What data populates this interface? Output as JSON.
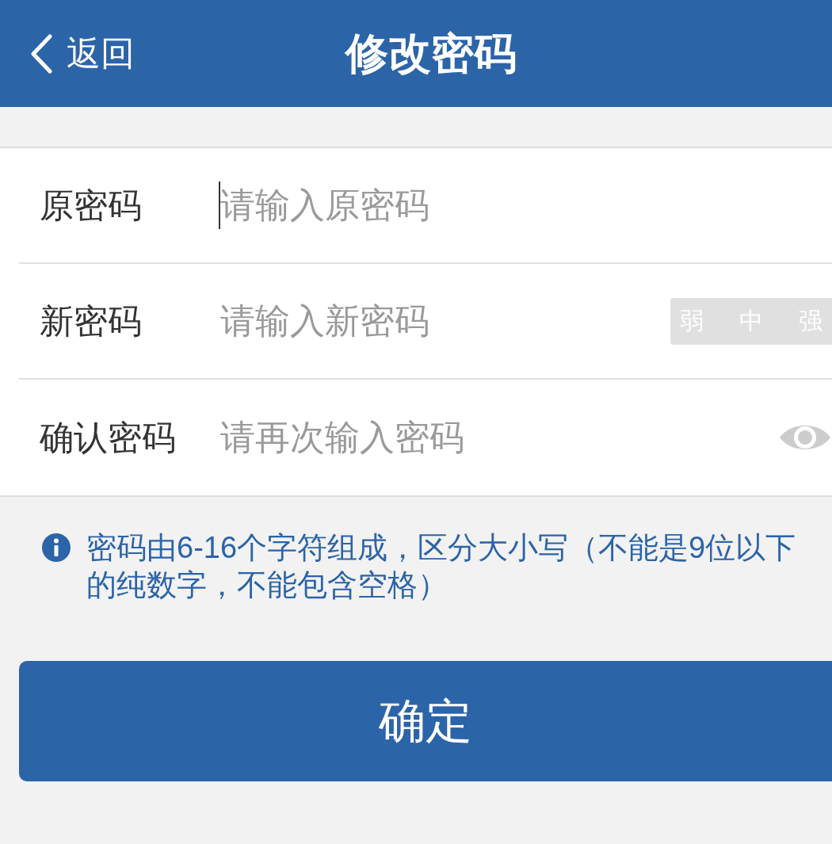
{
  "header": {
    "back_label": "返回",
    "title": "修改密码"
  },
  "fields": [
    {
      "kind": "plain",
      "label": "原密码",
      "placeholder": "请输入原密码",
      "focused": true
    },
    {
      "kind": "strength",
      "label": "新密码",
      "placeholder": "请输入新密码",
      "focused": false,
      "strength": [
        {
          "label": "弱",
          "active": false
        },
        {
          "label": "中",
          "active": false
        },
        {
          "label": "强",
          "active": false
        }
      ]
    },
    {
      "kind": "reveal",
      "label": "确认密码",
      "placeholder": "请再次输入密码",
      "focused": false
    }
  ],
  "hint": "密码由6-16个字符组成，区分大小写（不能是9位以下的纯数字，不能包含空格）",
  "submit": "确定"
}
